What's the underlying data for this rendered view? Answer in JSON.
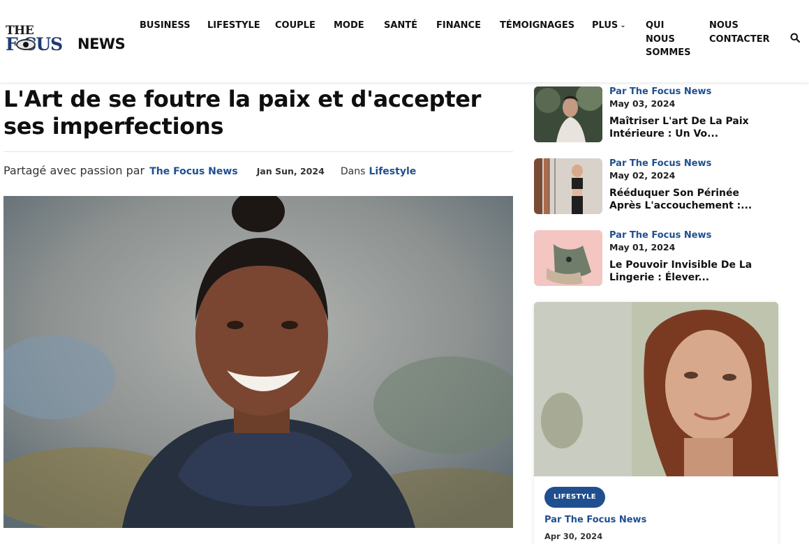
{
  "logo": {
    "the": "THE",
    "focus": "F CUS",
    "news": "NEWS"
  },
  "nav": {
    "items": [
      {
        "label": "BUSINESS"
      },
      {
        "label": "LIFESTYLE"
      },
      {
        "label": "COUPLE"
      },
      {
        "label": "MODE"
      },
      {
        "label": "SANTÉ"
      },
      {
        "label": "FINANCE"
      },
      {
        "label": "TÉMOIGNAGES"
      },
      {
        "label": "PLUS"
      },
      {
        "label": "QUI NOUS SOMMES"
      },
      {
        "label": "NOUS CONTACTER"
      }
    ],
    "plus_icon": "chevron-down-icon",
    "search_icon": "search-icon"
  },
  "article": {
    "title": "L'Art de se foutre la paix et d'accepter ses imperfections",
    "shared_prefix": "Partagé avec passion par",
    "author": "The Focus News",
    "date": "Jan Sun, 2024",
    "dans": "Dans",
    "category": "Lifestyle"
  },
  "sidebar": {
    "items": [
      {
        "by": "Par The Focus News",
        "date": "May 03, 2024",
        "title": "Maîtriser L'art De La Paix Intérieure : Un Vo..."
      },
      {
        "by": "Par The Focus News",
        "date": "May 02, 2024",
        "title": "Rééduquer Son Périnée Après L'accouchement :..."
      },
      {
        "by": "Par The Focus News",
        "date": "May 01, 2024",
        "title": "Le Pouvoir Invisible De La Lingerie : Élever..."
      }
    ]
  },
  "feature_card": {
    "badge": "LIFESTYLE",
    "by": "Par The Focus News",
    "date": "Apr 30, 2024"
  },
  "colors": {
    "accent": "#1f4f8f",
    "text": "#111111"
  }
}
